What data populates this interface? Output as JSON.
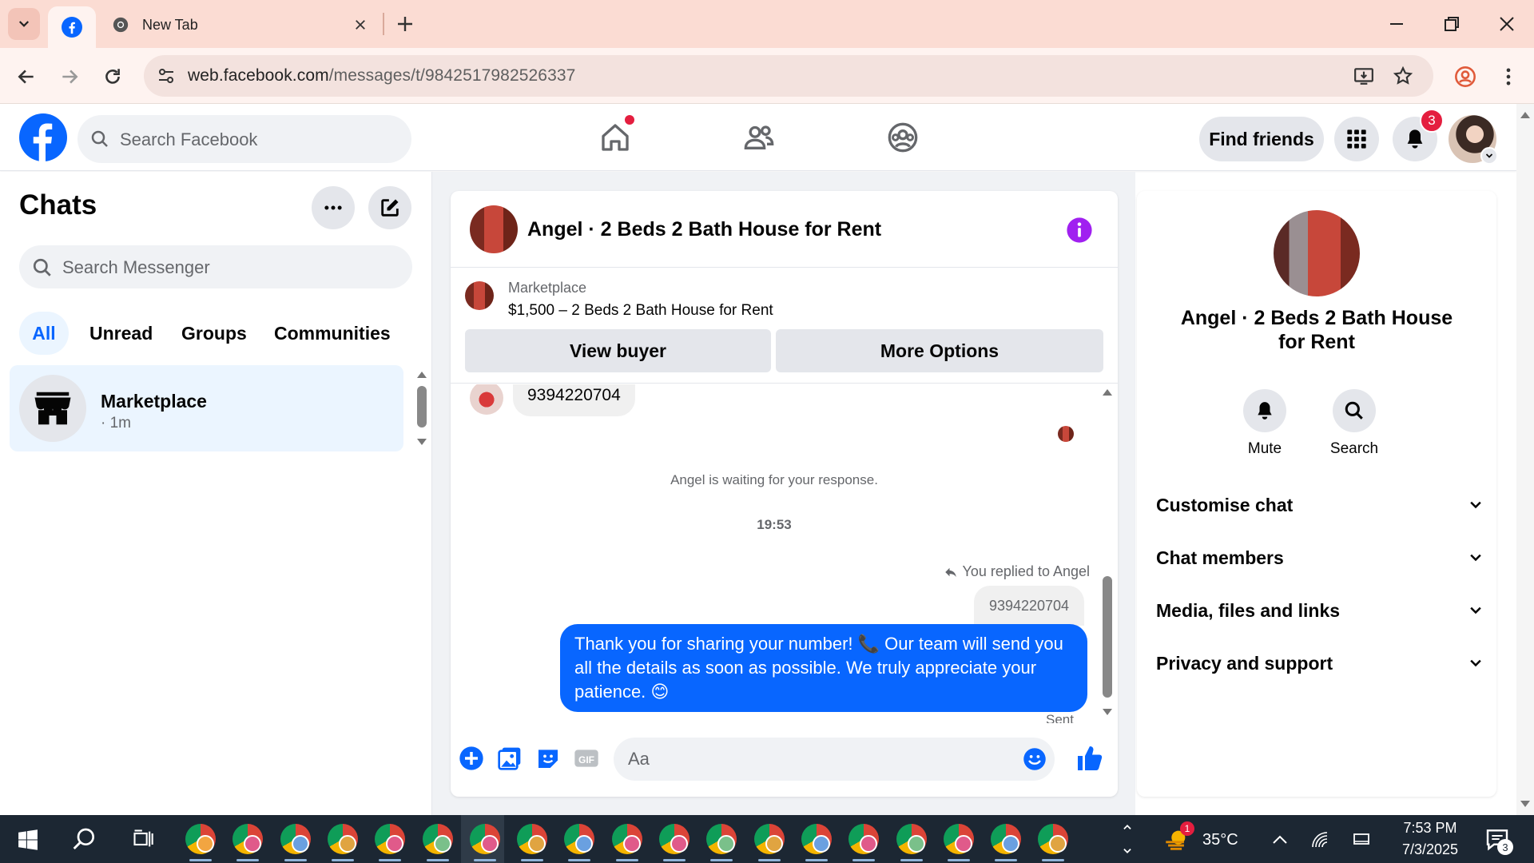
{
  "browser": {
    "tab_title": "New Tab",
    "url_host": "web.facebook.com",
    "url_path": "/messages/t/9842517982526337"
  },
  "header": {
    "search_placeholder": "Search Facebook",
    "find_friends": "Find friends",
    "notification_count": "3"
  },
  "chats": {
    "title": "Chats",
    "search_placeholder": "Search Messenger",
    "filters": [
      "All",
      "Unread",
      "Groups",
      "Communities"
    ],
    "active_filter": "All",
    "items": [
      {
        "name": "Marketplace",
        "time": "· 1m"
      }
    ]
  },
  "conversation": {
    "title": "Angel · 2 Beds 2 Bath House for Rent",
    "listing_source": "Marketplace",
    "listing_title": "$1,500 – 2 Beds 2 Bath House for Rent",
    "view_buyer": "View buyer",
    "more_options": "More Options",
    "messages": {
      "incoming_number": "9394220704",
      "waiting_notice": "Angel is waiting for your response.",
      "timestamp": "19:53",
      "replied_to": "You replied to Angel",
      "quoted_number": "9394220704",
      "outgoing_text": "Thank you for sharing your number! 📞 Our team will send you all the details as soon as possible. We truly appreciate your patience. 😊",
      "status": "Sent"
    },
    "composer_placeholder": "Aa"
  },
  "details": {
    "title": "Angel · 2 Beds 2 Bath House for Rent",
    "actions": [
      "Mute",
      "Search"
    ],
    "sections": [
      "Customise chat",
      "Chat members",
      "Media, files and links",
      "Privacy and support"
    ]
  },
  "taskbar": {
    "temperature": "35°C",
    "weather_badge": "1",
    "time": "7:53 PM",
    "date": "7/3/2025",
    "notification_count": "3"
  },
  "colors": {
    "facebook_blue": "#0866ff",
    "accent_purple": "#a020f0",
    "badge_red": "#e41e3f",
    "selected_bg": "#ebf5ff"
  }
}
